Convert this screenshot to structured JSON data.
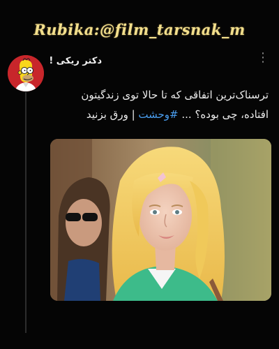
{
  "banner": {
    "text": "Rubika:@film_tarsnak_m"
  },
  "post": {
    "author_name": "دکتر ریکی !",
    "text_part1": "ترسناک‌ترین اتفاقی که تا حالا توی زندگیتون افتاده، چی بوده؟ ... ",
    "hashtag": "#وحشت",
    "text_part2": " | ورق بزنید",
    "more_icon": "more-options-icon",
    "avatar_icon": "cartoon-avatar"
  },
  "colors": {
    "background": "#050505",
    "banner": "#f3df8c",
    "text": "#ececec",
    "hashtag": "#4a9ef0",
    "avatar_bg": "#c8262b"
  }
}
